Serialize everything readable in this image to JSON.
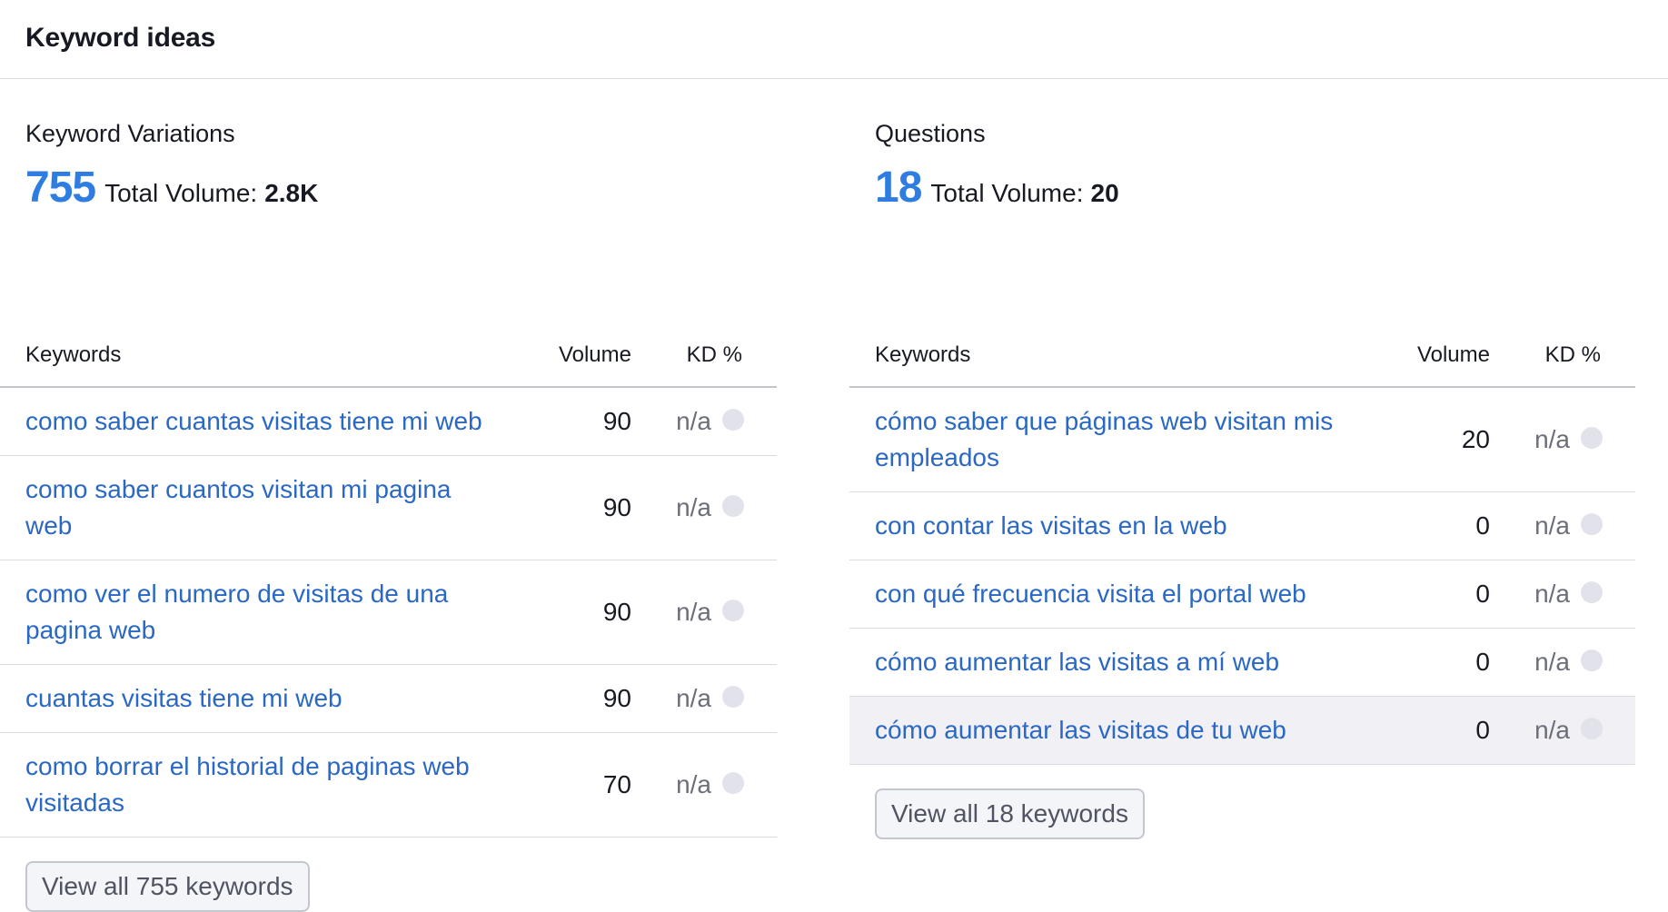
{
  "header": {
    "title": "Keyword ideas"
  },
  "columns": {
    "keywords": "Keywords",
    "volume": "Volume",
    "kd": "KD %"
  },
  "variations": {
    "title": "Keyword Variations",
    "count": "755",
    "total_volume_label": "Total Volume:",
    "total_volume_value": "2.8K",
    "rows": [
      {
        "keyword": "como saber cuantas visitas tiene mi web",
        "volume": "90",
        "kd": "n/a"
      },
      {
        "keyword": "como saber cuantos visitan mi pagina web",
        "volume": "90",
        "kd": "n/a"
      },
      {
        "keyword": "como ver el numero de visitas de una pagina web",
        "volume": "90",
        "kd": "n/a"
      },
      {
        "keyword": "cuantas visitas tiene mi web",
        "volume": "90",
        "kd": "n/a"
      },
      {
        "keyword": "como borrar el historial de paginas web visitadas",
        "volume": "70",
        "kd": "n/a"
      }
    ],
    "view_all_label": "View all 755 keywords"
  },
  "questions": {
    "title": "Questions",
    "count": "18",
    "total_volume_label": "Total Volume:",
    "total_volume_value": "20",
    "rows": [
      {
        "keyword": "cómo saber que páginas web visitan mis empleados",
        "volume": "20",
        "kd": "n/a"
      },
      {
        "keyword": "con contar las visitas en la web",
        "volume": "0",
        "kd": "n/a"
      },
      {
        "keyword": "con qué frecuencia visita el portal web",
        "volume": "0",
        "kd": "n/a"
      },
      {
        "keyword": "cómo aumentar las visitas a mí web",
        "volume": "0",
        "kd": "n/a"
      },
      {
        "keyword": "cómo aumentar las visitas de tu web",
        "volume": "0",
        "kd": "n/a"
      }
    ],
    "view_all_label": "View all 18 keywords"
  },
  "colors": {
    "accent": "#2f7de1",
    "link": "#2a68c4",
    "kd_dot": "#e2e3ea",
    "row_highlight": "#f0f0f5"
  }
}
